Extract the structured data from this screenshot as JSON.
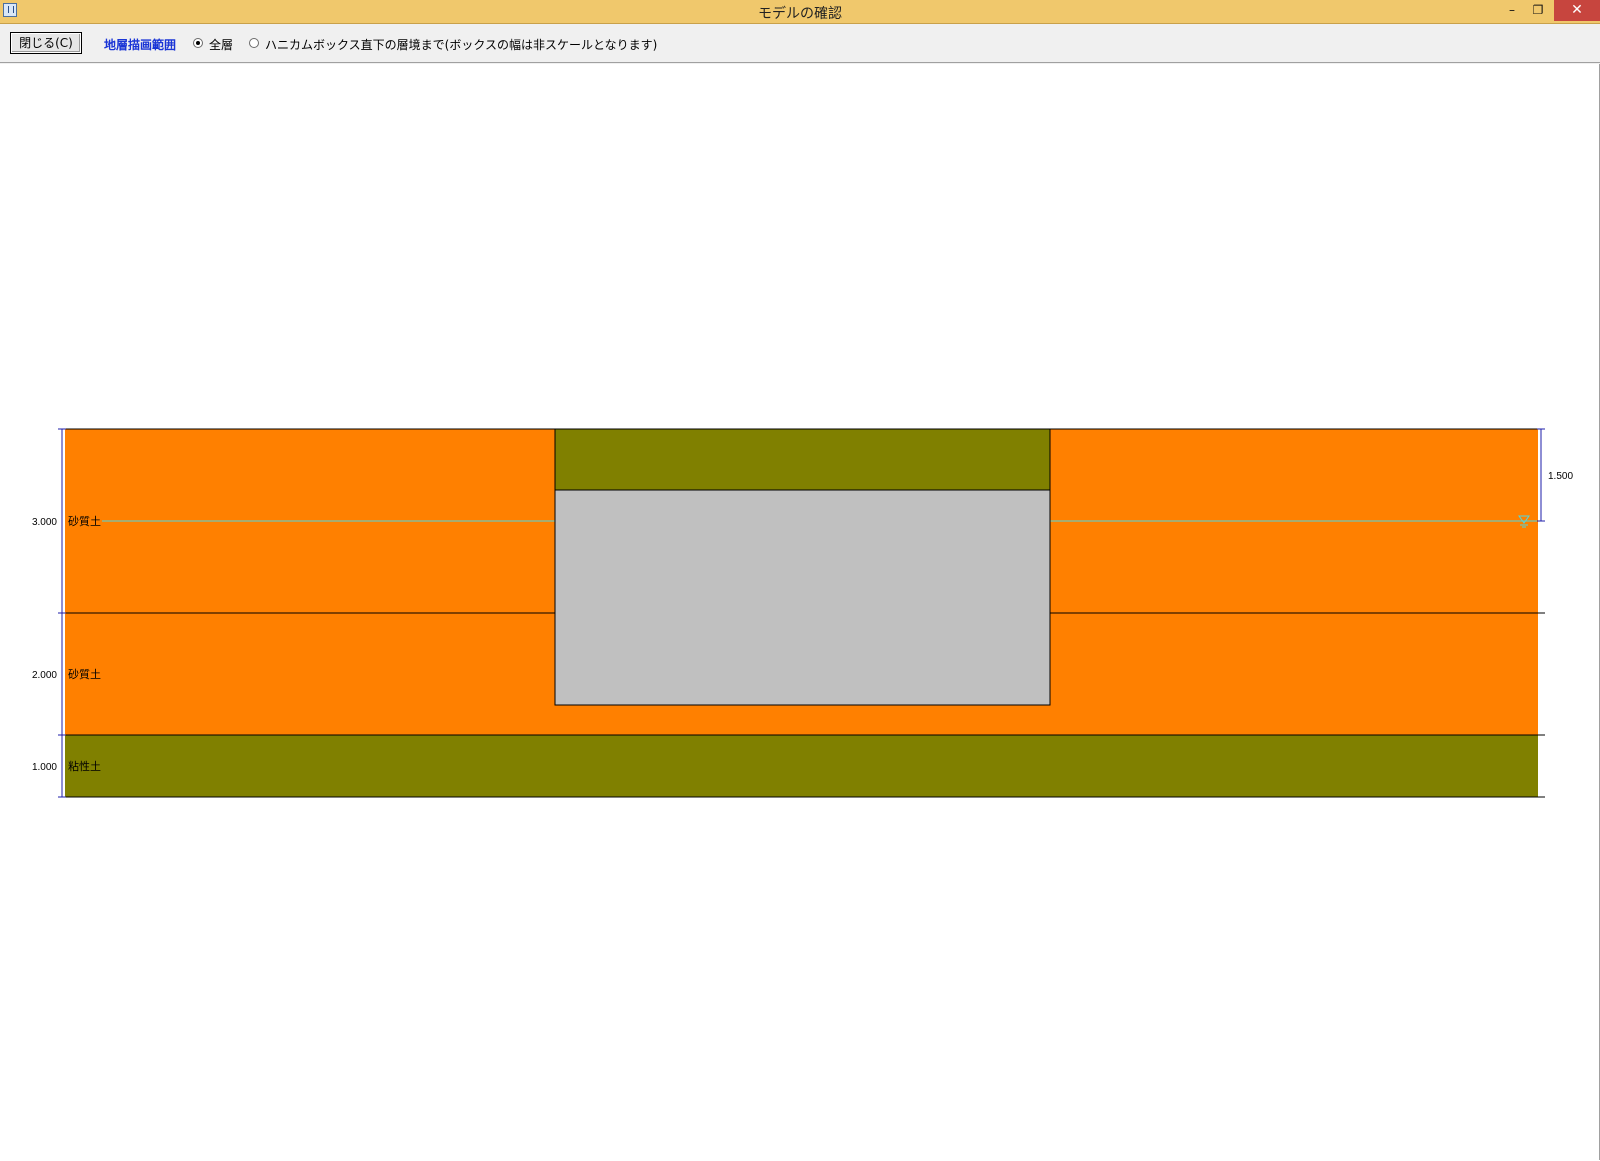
{
  "window": {
    "title": "モデルの確認",
    "minimize_glyph": "–",
    "restore_glyph": "❐",
    "close_glyph": "✕"
  },
  "toolbar": {
    "close_label": "閉じる(C)",
    "range_label": "地層描画範囲",
    "options": [
      {
        "label": "全層",
        "selected": true
      },
      {
        "label": "ハニカムボックス直下の層境まで(ボックスの幅は非スケールとなります)",
        "selected": false
      }
    ]
  },
  "model": {
    "layers": [
      {
        "thickness_label": "3.000",
        "soil": "砂質土",
        "color": "#ff8000"
      },
      {
        "thickness_label": "2.000",
        "soil": "砂質土",
        "color": "#ff8000"
      },
      {
        "thickness_label": "1.000",
        "soil": "粘性土",
        "color": "#808000"
      }
    ],
    "water_level_label": "1.500",
    "water_color": "#4fd8e0",
    "box_cover_color": "#808000",
    "box_color": "#c0c0c0",
    "dimension_color": "#1c1ca8",
    "icons": [
      "water-level-icon"
    ]
  }
}
